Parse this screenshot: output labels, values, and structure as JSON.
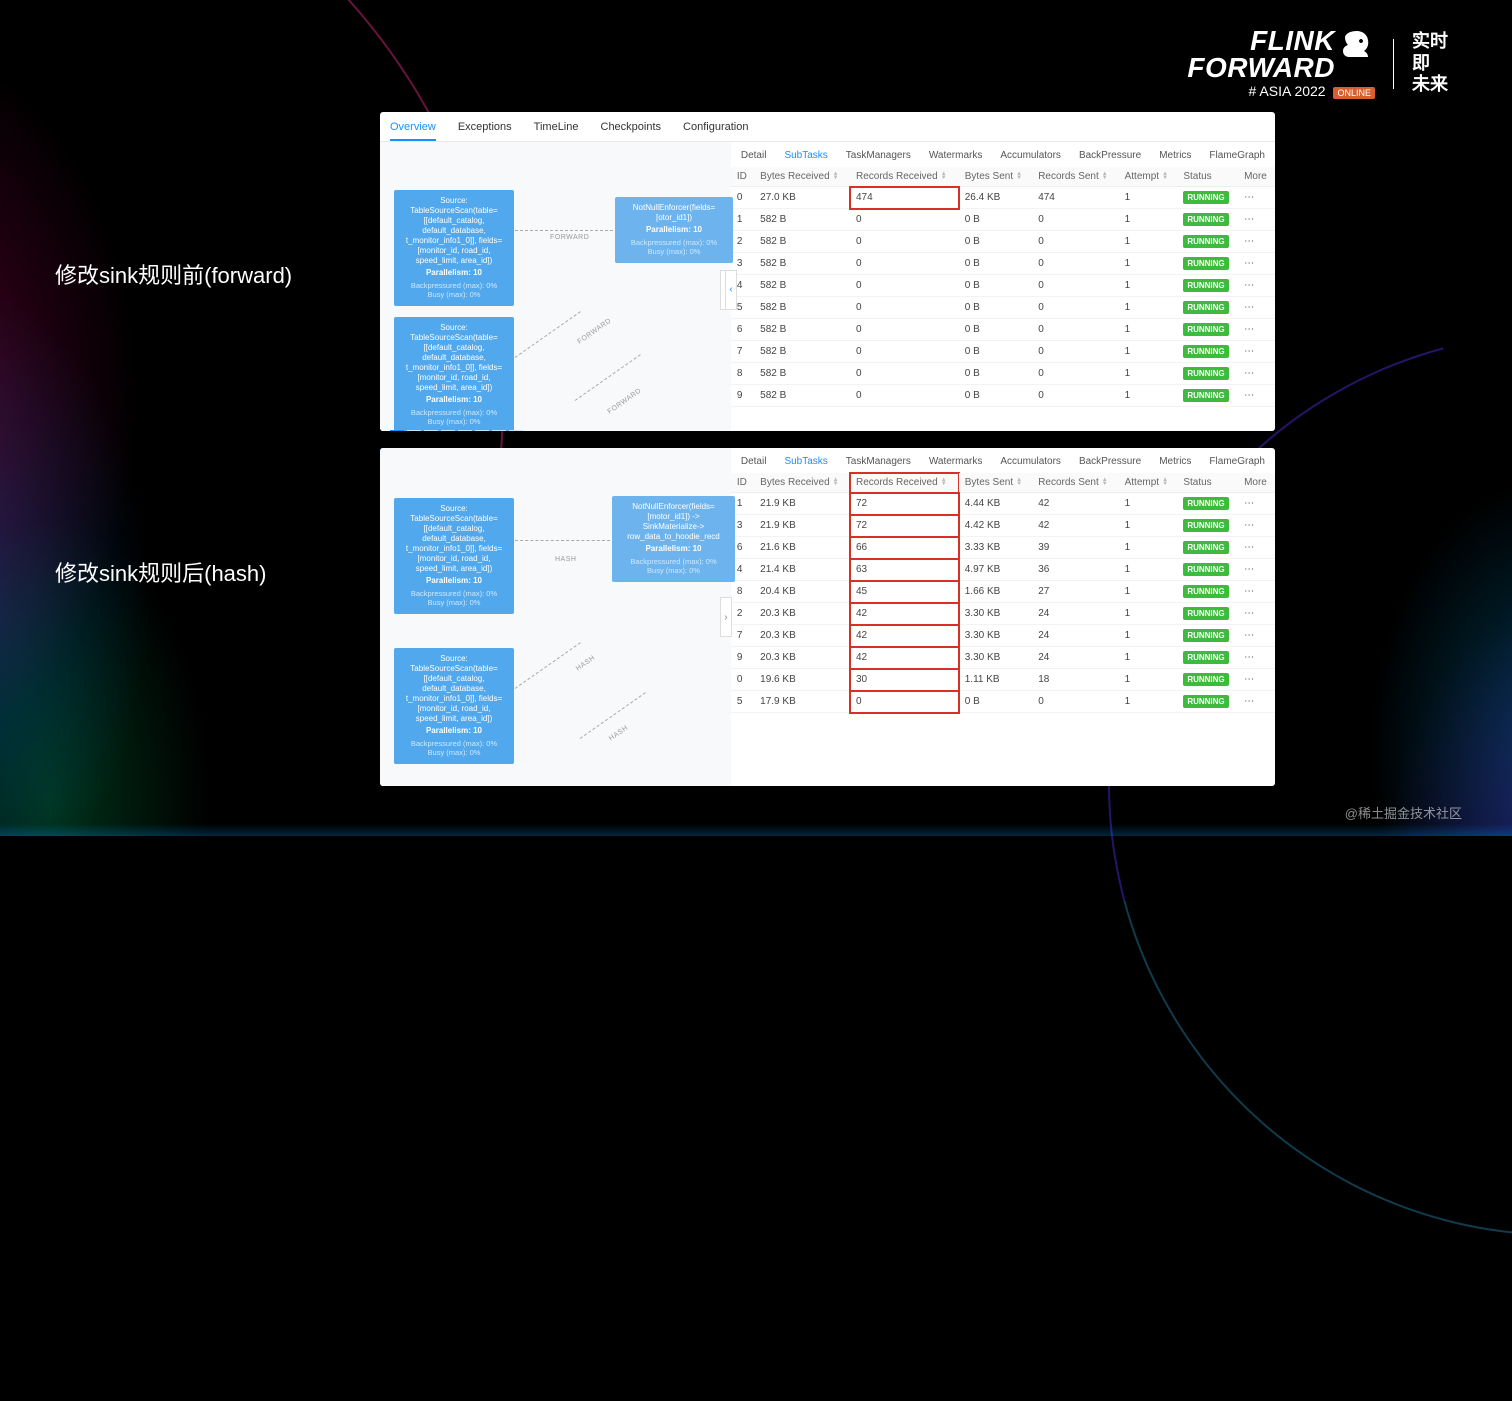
{
  "logo": {
    "line1": "FLINK",
    "line2": "FORWARD",
    "asia": "# ASIA 2022",
    "online": "ONLINE",
    "cn": "实时即\n未来"
  },
  "labels": {
    "before": "修改sink规则前(forward)",
    "after": "修改sink规则后(hash)"
  },
  "topTabs": [
    "Overview",
    "Exceptions",
    "TimeLine",
    "Checkpoints",
    "Configuration"
  ],
  "subTabs": [
    "Detail",
    "SubTasks",
    "TaskManagers",
    "Watermarks",
    "Accumulators",
    "BackPressure",
    "Metrics",
    "FlameGraph"
  ],
  "columns": [
    "ID",
    "Bytes Received",
    "Records Received",
    "Bytes Sent",
    "Records Sent",
    "Attempt",
    "Status",
    "More"
  ],
  "graph": {
    "source": "Source: TableSourceScan(table=[[default_catalog, default_database, t_monitor_info1_0]], fields=[monitor_id, road_id, speed_limit, area_id])",
    "parallelism": "Parallelism: 10",
    "bp": "Backpressured (max): 0%",
    "busy": "Busy (max): 0%",
    "enforcer1": "NotNullEnforcer(fields=[otor_id1])",
    "enforcer2": "NotNullEnforcer(fields=[motor_id1]) -> SinkMaterialize-> row_data_to_hoodie_recd",
    "edgeForward": "FORWARD",
    "edgeHash": "HASH"
  },
  "status": "RUNNING",
  "rows1": [
    {
      "id": "0",
      "br": "27.0 KB",
      "rr": "474",
      "bs": "26.4 KB",
      "rs": "474",
      "a": "1",
      "hl": true
    },
    {
      "id": "1",
      "br": "582 B",
      "rr": "0",
      "bs": "0 B",
      "rs": "0",
      "a": "1"
    },
    {
      "id": "2",
      "br": "582 B",
      "rr": "0",
      "bs": "0 B",
      "rs": "0",
      "a": "1"
    },
    {
      "id": "3",
      "br": "582 B",
      "rr": "0",
      "bs": "0 B",
      "rs": "0",
      "a": "1"
    },
    {
      "id": "4",
      "br": "582 B",
      "rr": "0",
      "bs": "0 B",
      "rs": "0",
      "a": "1"
    },
    {
      "id": "5",
      "br": "582 B",
      "rr": "0",
      "bs": "0 B",
      "rs": "0",
      "a": "1"
    },
    {
      "id": "6",
      "br": "582 B",
      "rr": "0",
      "bs": "0 B",
      "rs": "0",
      "a": "1"
    },
    {
      "id": "7",
      "br": "582 B",
      "rr": "0",
      "bs": "0 B",
      "rs": "0",
      "a": "1"
    },
    {
      "id": "8",
      "br": "582 B",
      "rr": "0",
      "bs": "0 B",
      "rs": "0",
      "a": "1"
    },
    {
      "id": "9",
      "br": "582 B",
      "rr": "0",
      "bs": "0 B",
      "rs": "0",
      "a": "1"
    }
  ],
  "rows2": [
    {
      "id": "1",
      "br": "21.9 KB",
      "rr": "72",
      "bs": "4.44 KB",
      "rs": "42",
      "a": "1"
    },
    {
      "id": "3",
      "br": "21.9 KB",
      "rr": "72",
      "bs": "4.42 KB",
      "rs": "42",
      "a": "1"
    },
    {
      "id": "6",
      "br": "21.6 KB",
      "rr": "66",
      "bs": "3.33 KB",
      "rs": "39",
      "a": "1"
    },
    {
      "id": "4",
      "br": "21.4 KB",
      "rr": "63",
      "bs": "4.97 KB",
      "rs": "36",
      "a": "1"
    },
    {
      "id": "8",
      "br": "20.4 KB",
      "rr": "45",
      "bs": "1.66 KB",
      "rs": "27",
      "a": "1"
    },
    {
      "id": "2",
      "br": "20.3 KB",
      "rr": "42",
      "bs": "3.30 KB",
      "rs": "24",
      "a": "1"
    },
    {
      "id": "7",
      "br": "20.3 KB",
      "rr": "42",
      "bs": "3.30 KB",
      "rs": "24",
      "a": "1"
    },
    {
      "id": "9",
      "br": "20.3 KB",
      "rr": "42",
      "bs": "3.30 KB",
      "rs": "24",
      "a": "1"
    },
    {
      "id": "0",
      "br": "19.6 KB",
      "rr": "30",
      "bs": "1.11 KB",
      "rs": "18",
      "a": "1"
    },
    {
      "id": "5",
      "br": "17.9 KB",
      "rr": "0",
      "bs": "0 B",
      "rs": "0",
      "a": "1"
    }
  ],
  "watermark": "@稀土掘金技术社区"
}
